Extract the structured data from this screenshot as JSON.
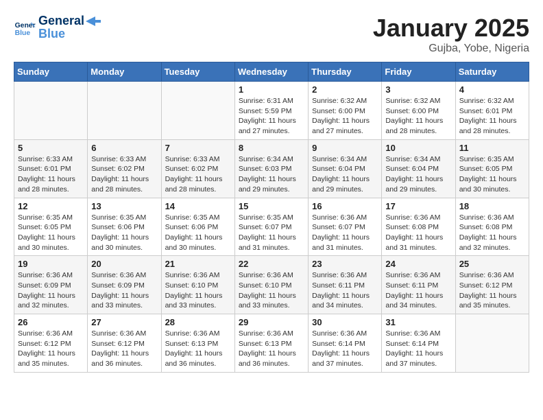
{
  "logo": {
    "line1": "General",
    "line2": "Blue"
  },
  "title": "January 2025",
  "subtitle": "Gujba, Yobe, Nigeria",
  "days_of_week": [
    "Sunday",
    "Monday",
    "Tuesday",
    "Wednesday",
    "Thursday",
    "Friday",
    "Saturday"
  ],
  "weeks": [
    [
      {
        "day": "",
        "info": ""
      },
      {
        "day": "",
        "info": ""
      },
      {
        "day": "",
        "info": ""
      },
      {
        "day": "1",
        "info": "Sunrise: 6:31 AM\nSunset: 5:59 PM\nDaylight: 11 hours and 27 minutes."
      },
      {
        "day": "2",
        "info": "Sunrise: 6:32 AM\nSunset: 6:00 PM\nDaylight: 11 hours and 27 minutes."
      },
      {
        "day": "3",
        "info": "Sunrise: 6:32 AM\nSunset: 6:00 PM\nDaylight: 11 hours and 28 minutes."
      },
      {
        "day": "4",
        "info": "Sunrise: 6:32 AM\nSunset: 6:01 PM\nDaylight: 11 hours and 28 minutes."
      }
    ],
    [
      {
        "day": "5",
        "info": "Sunrise: 6:33 AM\nSunset: 6:01 PM\nDaylight: 11 hours and 28 minutes."
      },
      {
        "day": "6",
        "info": "Sunrise: 6:33 AM\nSunset: 6:02 PM\nDaylight: 11 hours and 28 minutes."
      },
      {
        "day": "7",
        "info": "Sunrise: 6:33 AM\nSunset: 6:02 PM\nDaylight: 11 hours and 28 minutes."
      },
      {
        "day": "8",
        "info": "Sunrise: 6:34 AM\nSunset: 6:03 PM\nDaylight: 11 hours and 29 minutes."
      },
      {
        "day": "9",
        "info": "Sunrise: 6:34 AM\nSunset: 6:04 PM\nDaylight: 11 hours and 29 minutes."
      },
      {
        "day": "10",
        "info": "Sunrise: 6:34 AM\nSunset: 6:04 PM\nDaylight: 11 hours and 29 minutes."
      },
      {
        "day": "11",
        "info": "Sunrise: 6:35 AM\nSunset: 6:05 PM\nDaylight: 11 hours and 30 minutes."
      }
    ],
    [
      {
        "day": "12",
        "info": "Sunrise: 6:35 AM\nSunset: 6:05 PM\nDaylight: 11 hours and 30 minutes."
      },
      {
        "day": "13",
        "info": "Sunrise: 6:35 AM\nSunset: 6:06 PM\nDaylight: 11 hours and 30 minutes."
      },
      {
        "day": "14",
        "info": "Sunrise: 6:35 AM\nSunset: 6:06 PM\nDaylight: 11 hours and 30 minutes."
      },
      {
        "day": "15",
        "info": "Sunrise: 6:35 AM\nSunset: 6:07 PM\nDaylight: 11 hours and 31 minutes."
      },
      {
        "day": "16",
        "info": "Sunrise: 6:36 AM\nSunset: 6:07 PM\nDaylight: 11 hours and 31 minutes."
      },
      {
        "day": "17",
        "info": "Sunrise: 6:36 AM\nSunset: 6:08 PM\nDaylight: 11 hours and 31 minutes."
      },
      {
        "day": "18",
        "info": "Sunrise: 6:36 AM\nSunset: 6:08 PM\nDaylight: 11 hours and 32 minutes."
      }
    ],
    [
      {
        "day": "19",
        "info": "Sunrise: 6:36 AM\nSunset: 6:09 PM\nDaylight: 11 hours and 32 minutes."
      },
      {
        "day": "20",
        "info": "Sunrise: 6:36 AM\nSunset: 6:09 PM\nDaylight: 11 hours and 33 minutes."
      },
      {
        "day": "21",
        "info": "Sunrise: 6:36 AM\nSunset: 6:10 PM\nDaylight: 11 hours and 33 minutes."
      },
      {
        "day": "22",
        "info": "Sunrise: 6:36 AM\nSunset: 6:10 PM\nDaylight: 11 hours and 33 minutes."
      },
      {
        "day": "23",
        "info": "Sunrise: 6:36 AM\nSunset: 6:11 PM\nDaylight: 11 hours and 34 minutes."
      },
      {
        "day": "24",
        "info": "Sunrise: 6:36 AM\nSunset: 6:11 PM\nDaylight: 11 hours and 34 minutes."
      },
      {
        "day": "25",
        "info": "Sunrise: 6:36 AM\nSunset: 6:12 PM\nDaylight: 11 hours and 35 minutes."
      }
    ],
    [
      {
        "day": "26",
        "info": "Sunrise: 6:36 AM\nSunset: 6:12 PM\nDaylight: 11 hours and 35 minutes."
      },
      {
        "day": "27",
        "info": "Sunrise: 6:36 AM\nSunset: 6:12 PM\nDaylight: 11 hours and 36 minutes."
      },
      {
        "day": "28",
        "info": "Sunrise: 6:36 AM\nSunset: 6:13 PM\nDaylight: 11 hours and 36 minutes."
      },
      {
        "day": "29",
        "info": "Sunrise: 6:36 AM\nSunset: 6:13 PM\nDaylight: 11 hours and 36 minutes."
      },
      {
        "day": "30",
        "info": "Sunrise: 6:36 AM\nSunset: 6:14 PM\nDaylight: 11 hours and 37 minutes."
      },
      {
        "day": "31",
        "info": "Sunrise: 6:36 AM\nSunset: 6:14 PM\nDaylight: 11 hours and 37 minutes."
      },
      {
        "day": "",
        "info": ""
      }
    ]
  ]
}
